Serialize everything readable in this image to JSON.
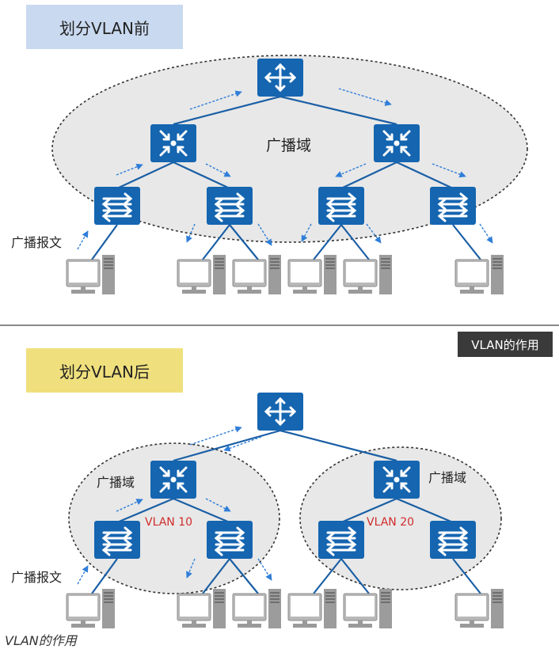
{
  "before": {
    "title": "划分VLAN前",
    "domain_label": "广播域",
    "broadcast_label": "广播报文"
  },
  "after": {
    "title": "划分VLAN后",
    "domain_label_left": "广播域",
    "domain_label_right": "广播域",
    "broadcast_label": "广播报文",
    "vlan_left": "VLAN 10",
    "vlan_right": "VLAN 20"
  },
  "badge": "VLAN的作用",
  "caption": "VLAN的作用",
  "colors": {
    "device_blue": "#1565b0",
    "link_blue": "#1a5fa5",
    "arrow_blue": "#2f7ed8",
    "vlan_red": "#d12b2b",
    "domain_fill": "#e8e8e8"
  },
  "icons": {
    "router": "router-icon",
    "core_switch": "core-switch-icon",
    "access_switch": "access-switch-icon",
    "pc": "pc-icon"
  }
}
